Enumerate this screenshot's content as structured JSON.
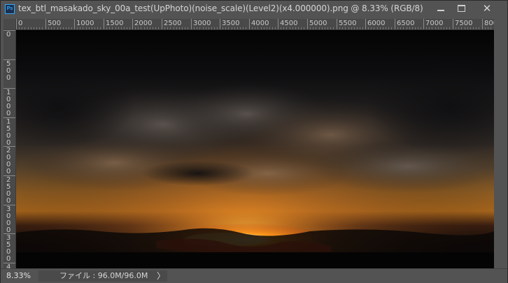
{
  "window": {
    "title": "tex_btl_masakado_sky_00a_test(UpPhoto)(noise_scale)(Level2)(x4.000000).png @ 8.33% (RGB/8)",
    "app_icon_text": "Ps"
  },
  "ruler": {
    "horizontal_labels": [
      "0",
      "500",
      "1000",
      "1500",
      "2000",
      "2500",
      "3000",
      "3500",
      "4000",
      "4500",
      "5000",
      "5500",
      "6000",
      "6500",
      "7000",
      "7500",
      "800"
    ],
    "vertical_labels": [
      "0",
      "5 0 0",
      "1 0 0 0",
      "1 5 0 0",
      "2 0 0 0",
      "2 5 0 0",
      "3 0 0 0",
      "3 5 0 0",
      "4"
    ]
  },
  "status": {
    "zoom": "8.33%",
    "file_info": "ファイル : 96.0M/96.0M",
    "arrow": "〉"
  },
  "colors": {
    "chrome": "#535353",
    "ruler": "#494949",
    "canvas_bg": "#050505",
    "sun_core": "#ff7a12",
    "sky_glow": "#c8761e"
  }
}
